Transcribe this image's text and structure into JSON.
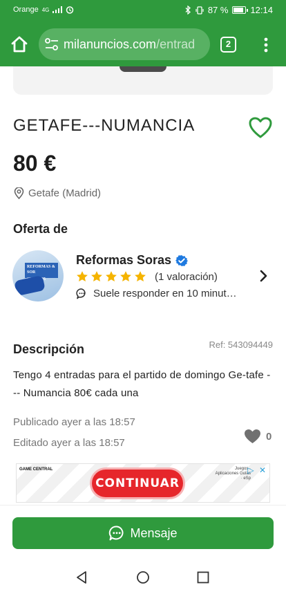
{
  "status_bar": {
    "carrier": "Orange",
    "network": "4G",
    "battery": "87 %",
    "battery_level": 0.87,
    "time": "12:14"
  },
  "browser": {
    "url_domain": "milanuncios.com",
    "url_path": "/entrad",
    "tab_count": "2"
  },
  "listing": {
    "title": "GETAFE---NUMANCIA",
    "price": "80 €",
    "location": "Getafe (Madrid)"
  },
  "seller": {
    "heading": "Oferta de",
    "name": "Reformas Soras",
    "rating_stars": 5,
    "rating_text": "(1 valoración)",
    "response": "Suele responder en 10 minut…",
    "avatar_text": [
      "REFORMAS & SOR",
      "698535925"
    ]
  },
  "description": {
    "heading": "Descripción",
    "ref": "Ref: 543094449",
    "text": "Tengo 4 entradas para el partido de domingo Ge-tafe --- Numancia 80€ cada una",
    "published": "Publicado ayer a las 18:57",
    "edited": "Editado ayer a las 18:57",
    "likes": "0"
  },
  "ad": {
    "logo": "GAME CENTRAL",
    "cta": "CONTINUAR",
    "side_text": "Juegos · Aplicaciones Guías · eSp",
    "choices": [
      "▷",
      "✕"
    ]
  },
  "actions": {
    "message_label": "Mensaje"
  },
  "colors": {
    "brand_green": "#2f9a3d",
    "star_yellow": "#f5b400",
    "verified_blue": "#1f7ae0",
    "ad_red": "#e6262b"
  },
  "icons": [
    "home-icon",
    "tune-icon",
    "overflow-menu-icon",
    "heart-outline-icon",
    "location-pin-icon",
    "verified-icon",
    "star-icon",
    "chat-bubble-icon",
    "chevron-right-icon",
    "heart-filled-icon",
    "nav-back-icon",
    "nav-home-icon",
    "nav-recent-icon"
  ]
}
